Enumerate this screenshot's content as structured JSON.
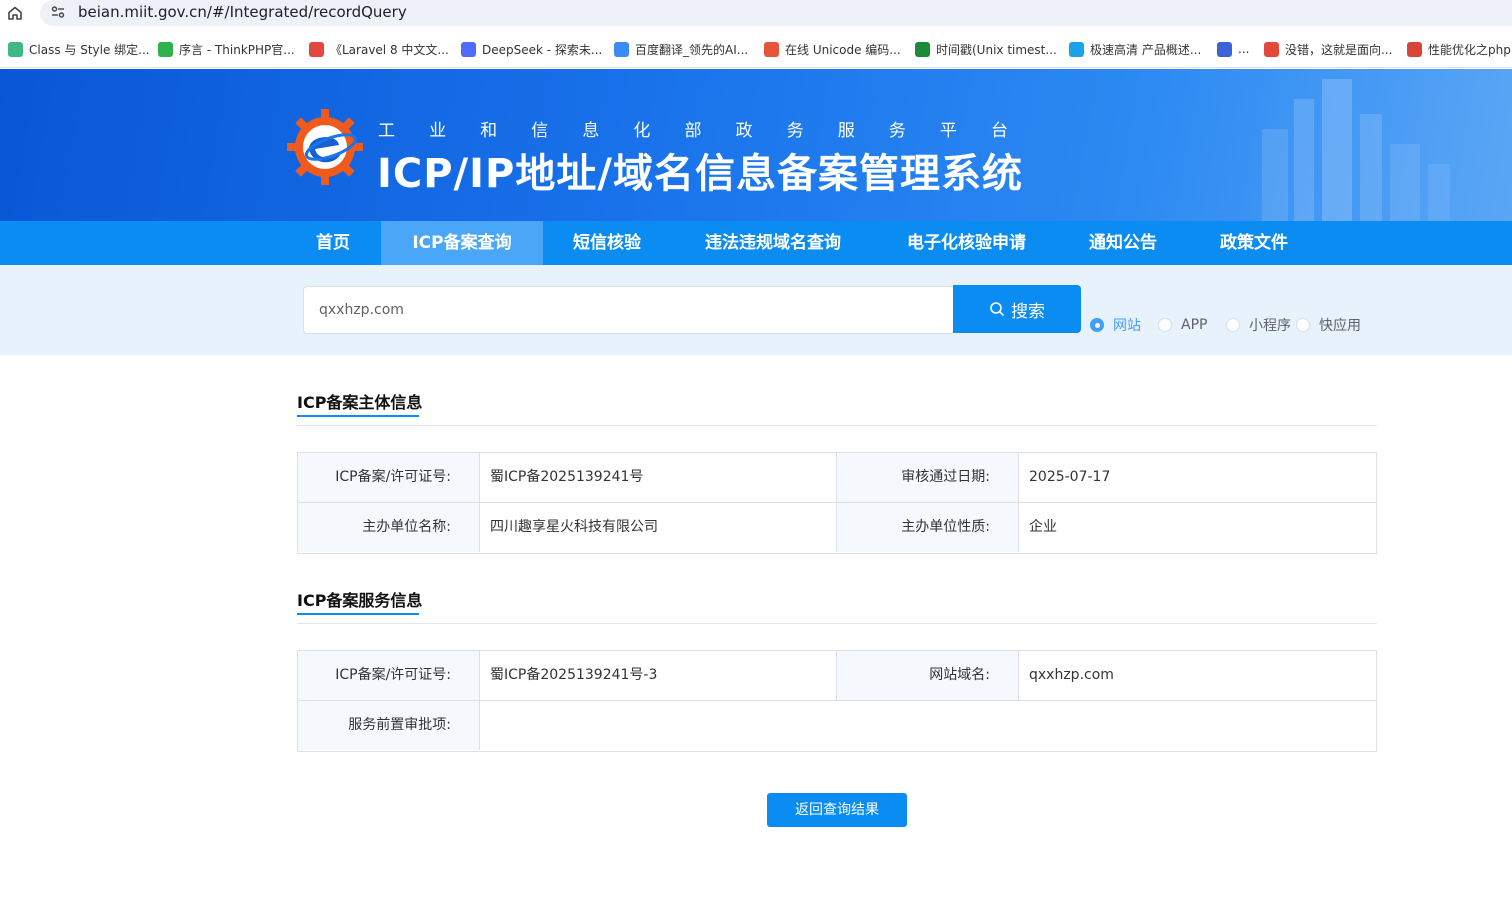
{
  "browser": {
    "url": "beian.miit.gov.cn/#/Integrated/recordQuery",
    "bookmarks": [
      {
        "label": "Class 与 Style 绑定...",
        "icon": "vue-icon",
        "color": "#41b883"
      },
      {
        "label": "序言 - ThinkPHP官...",
        "icon": "thinkphp-icon",
        "color": "#2bb24c"
      },
      {
        "label": "《Laravel 8 中文文...",
        "icon": "laravel-icon",
        "color": "#e3483f"
      },
      {
        "label": "DeepSeek - 探索未...",
        "icon": "deepseek-icon",
        "color": "#4d6bfe"
      },
      {
        "label": "百度翻译_领先的AI...",
        "icon": "baidu-translate-icon",
        "color": "#3a8af8"
      },
      {
        "label": "在线 Unicode 编码...",
        "icon": "unicode-icon",
        "color": "#e6553a"
      },
      {
        "label": "时间戳(Unix timest...",
        "icon": "timestamp-icon",
        "color": "#1d8a3a"
      },
      {
        "label": "极速高清 产品概述...",
        "icon": "cloud-icon",
        "color": "#1aa3e8"
      },
      {
        "label": "...",
        "icon": "rocket-icon",
        "color": "#3b62d6"
      },
      {
        "label": "没错，这就是面向...",
        "icon": "laravel-icon",
        "color": "#e3483f"
      },
      {
        "label": "性能优化之php",
        "icon": "jian-icon",
        "color": "#d8463a"
      }
    ]
  },
  "header": {
    "subtitle_chars": [
      "工",
      "业",
      "和",
      "信",
      "息",
      "化",
      "部",
      "政",
      "务",
      "服",
      "务",
      "平",
      "台"
    ],
    "title": "ICP/IP地址/域名信息备案管理系统"
  },
  "nav": {
    "items": [
      "首页",
      "ICP备案查询",
      "短信核验",
      "违法违规域名查询",
      "电子化核验申请",
      "通知公告",
      "政策文件"
    ],
    "active_index": 1
  },
  "search": {
    "value": "qxxhzp.com",
    "button_label": "搜索",
    "options": [
      "网站",
      "APP",
      "小程序",
      "快应用"
    ],
    "selected": "网站"
  },
  "subject_info": {
    "title": "ICP备案主体信息",
    "rows": [
      [
        {
          "label": "ICP备案/许可证号:",
          "value": "蜀ICP备2025139241号"
        },
        {
          "label": "审核通过日期:",
          "value": "2025-07-17"
        }
      ],
      [
        {
          "label": "主办单位名称:",
          "value": "四川趣享星火科技有限公司"
        },
        {
          "label": "主办单位性质:",
          "value": "企业"
        }
      ]
    ]
  },
  "service_info": {
    "title": "ICP备案服务信息",
    "row1": [
      {
        "label": "ICP备案/许可证号:",
        "value": "蜀ICP备2025139241号-3"
      },
      {
        "label": "网站域名:",
        "value": "qxxhzp.com"
      }
    ],
    "row2": {
      "label": "服务前置审批项:",
      "value": ""
    }
  },
  "back_button": "返回查询结果"
}
